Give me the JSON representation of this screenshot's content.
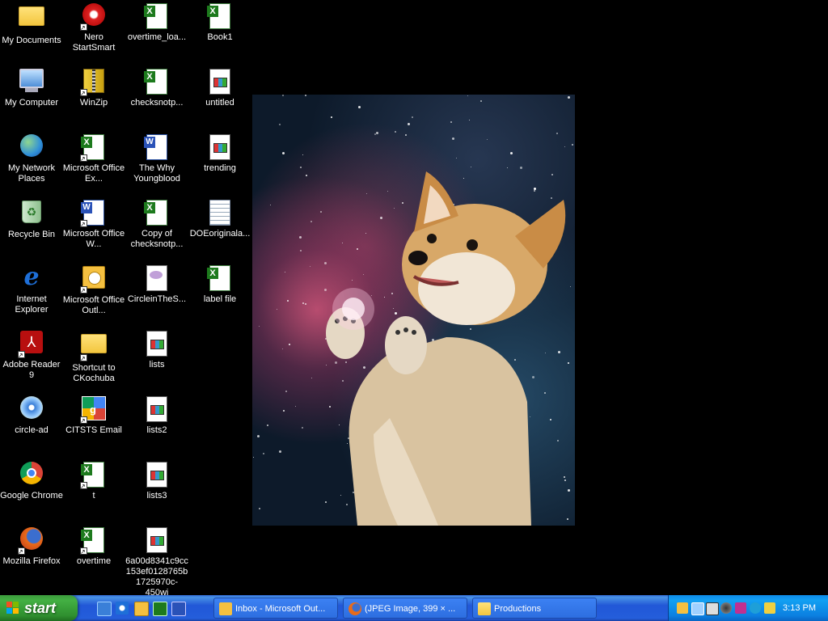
{
  "desktop": {
    "icons": [
      {
        "label": "My Documents"
      },
      {
        "label": "My Computer"
      },
      {
        "label": "My Network Places"
      },
      {
        "label": "Recycle Bin"
      },
      {
        "label": "Internet Explorer"
      },
      {
        "label": "Adobe Reader 9"
      },
      {
        "label": "circle-ad"
      },
      {
        "label": "Google Chrome"
      },
      {
        "label": "Mozilla Firefox"
      },
      {
        "label": "Nero StartSmart"
      },
      {
        "label": "WinZip"
      },
      {
        "label": "Microsoft Office Ex..."
      },
      {
        "label": "Microsoft Office W..."
      },
      {
        "label": "Microsoft Office Outl..."
      },
      {
        "label": "Shortcut to CKochuba"
      },
      {
        "label": "CITSTS Email"
      },
      {
        "label": "t"
      },
      {
        "label": "overtime"
      },
      {
        "label": "overtime_loa..."
      },
      {
        "label": "checksnotp..."
      },
      {
        "label": "The Why Youngblood"
      },
      {
        "label": "Copy of checksnotp..."
      },
      {
        "label": "CircleinTheS..."
      },
      {
        "label": "lists"
      },
      {
        "label": "lists2"
      },
      {
        "label": "lists3"
      },
      {
        "label": "6a00d8341c9cc153ef0128765b1725970c-450wi"
      },
      {
        "label": "Book1"
      },
      {
        "label": "untitled"
      },
      {
        "label": "trending"
      },
      {
        "label": "DOEoriginala..."
      },
      {
        "label": "label file"
      }
    ]
  },
  "taskbar": {
    "start_label": "start",
    "tasks": [
      {
        "label": "Inbox - Microsoft Out..."
      },
      {
        "label": "(JPEG Image, 399 × ..."
      },
      {
        "label": "Productions"
      }
    ],
    "clock": "3:13 PM"
  }
}
